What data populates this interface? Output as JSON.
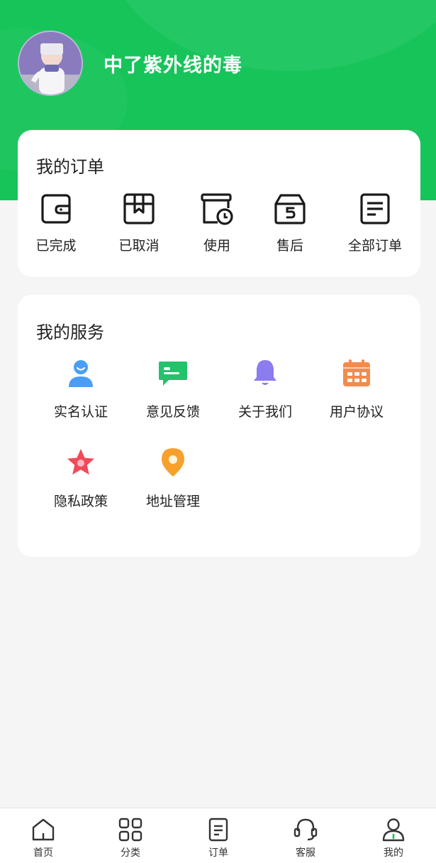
{
  "profile": {
    "username": "中了紫外线的毒"
  },
  "orders": {
    "title": "我的订单",
    "items": [
      {
        "label": "已完成",
        "icon": "wallet-icon"
      },
      {
        "label": "已取消",
        "icon": "box-icon"
      },
      {
        "label": "使用",
        "icon": "clock-document-icon"
      },
      {
        "label": "售后",
        "icon": "return-box-icon"
      },
      {
        "label": "全部订单",
        "icon": "list-document-icon"
      }
    ]
  },
  "services": {
    "title": "我的服务",
    "items": [
      {
        "label": "实名认证",
        "icon": "user-verify-icon"
      },
      {
        "label": "意见反馈",
        "icon": "chat-bubble-icon"
      },
      {
        "label": "关于我们",
        "icon": "bell-icon"
      },
      {
        "label": "用户协议",
        "icon": "calendar-icon"
      },
      {
        "label": "隐私政策",
        "icon": "star-icon"
      },
      {
        "label": "地址管理",
        "icon": "location-pin-icon"
      }
    ]
  },
  "tabbar": {
    "items": [
      {
        "label": "首页",
        "icon": "home-icon"
      },
      {
        "label": "分类",
        "icon": "grid-icon"
      },
      {
        "label": "订单",
        "icon": "document-icon"
      },
      {
        "label": "客服",
        "icon": "headset-icon"
      },
      {
        "label": "我的",
        "icon": "person-icon"
      }
    ]
  },
  "colors": {
    "brand_green": "#16c45a",
    "background": "#f5f5f5"
  }
}
